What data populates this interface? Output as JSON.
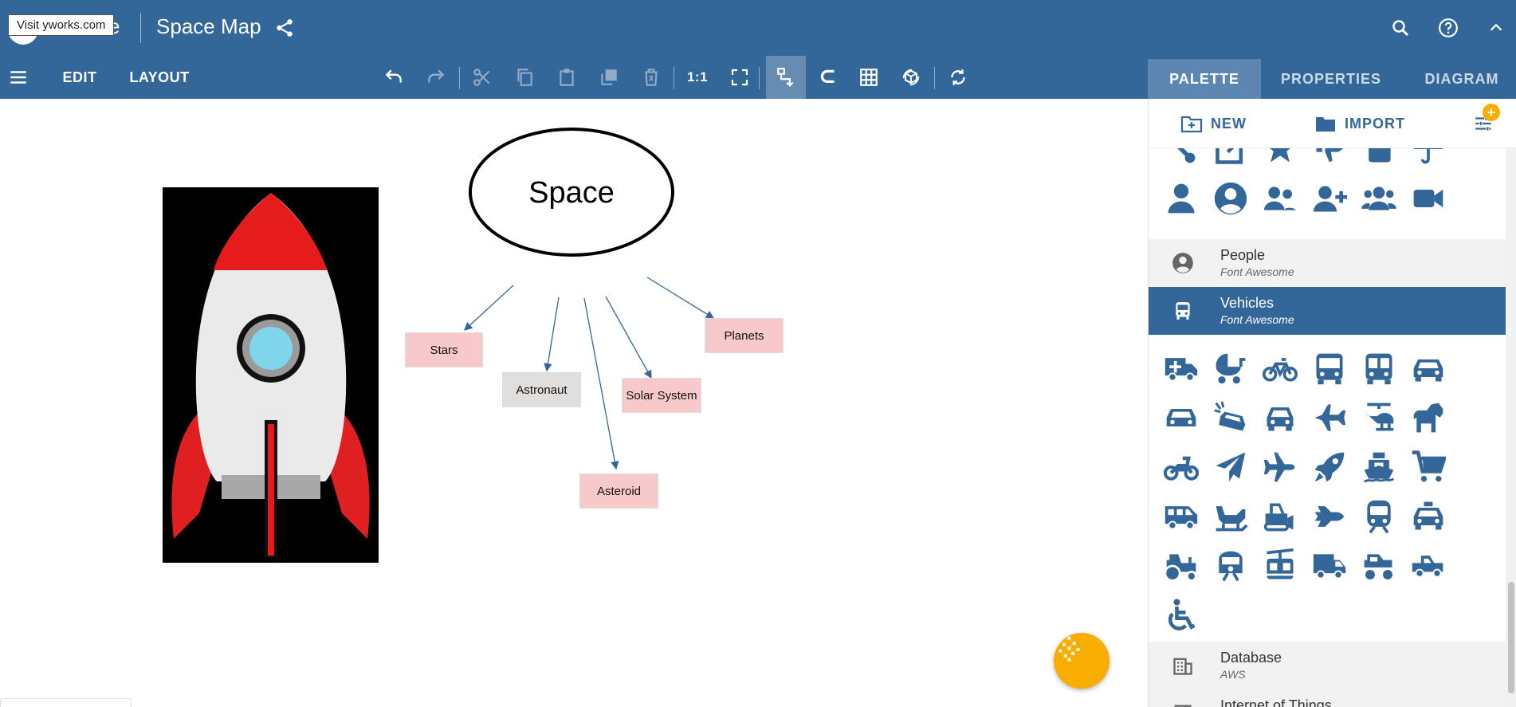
{
  "header": {
    "tooltip": "Visit yworks.com",
    "brand_tail": "e",
    "title": "Space Map"
  },
  "toolbar": {
    "edit_label": "EDIT",
    "layout_label": "LAYOUT",
    "zoom_one_label": "1:1"
  },
  "tabs": [
    "PALETTE",
    "PROPERTIES",
    "DIAGRAM"
  ],
  "panel": {
    "new_label": "NEW",
    "import_label": "IMPORT",
    "badge": "+",
    "categories": [
      {
        "title": "People",
        "subtitle": "Font Awesome"
      },
      {
        "title": "Vehicles",
        "subtitle": "Font Awesome"
      },
      {
        "title": "Database",
        "subtitle": "AWS"
      },
      {
        "title": "Internet of Things",
        "subtitle": ""
      }
    ]
  },
  "diagram": {
    "root": "Space",
    "children": [
      "Stars",
      "Astronaut",
      "Solar System",
      "Planets",
      "Asteroid"
    ]
  },
  "colors": {
    "primary": "#336699",
    "tab_active": "#5d86b3",
    "accent": "#f9ad00",
    "node_pink": "#f7c9cb",
    "node_grey": "#e1dfdd"
  }
}
